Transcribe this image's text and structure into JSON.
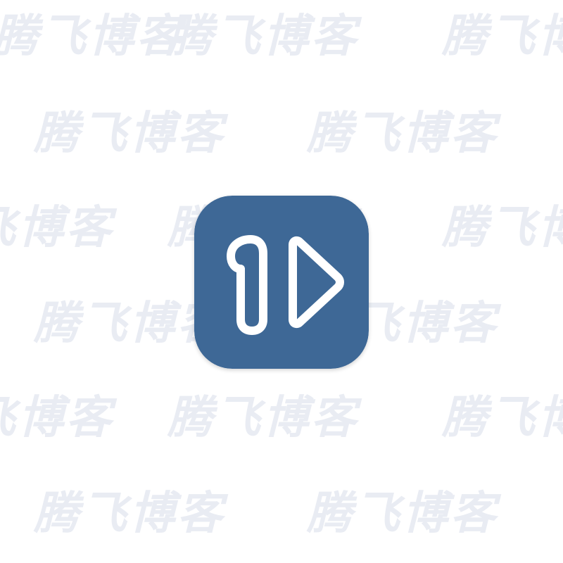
{
  "watermark": {
    "text": "腾飞博客",
    "color": "#e9ecf3"
  },
  "icon": {
    "name": "play-one-logo-icon",
    "background_color": "#3e6896",
    "glyph_color": "#ffffff"
  }
}
